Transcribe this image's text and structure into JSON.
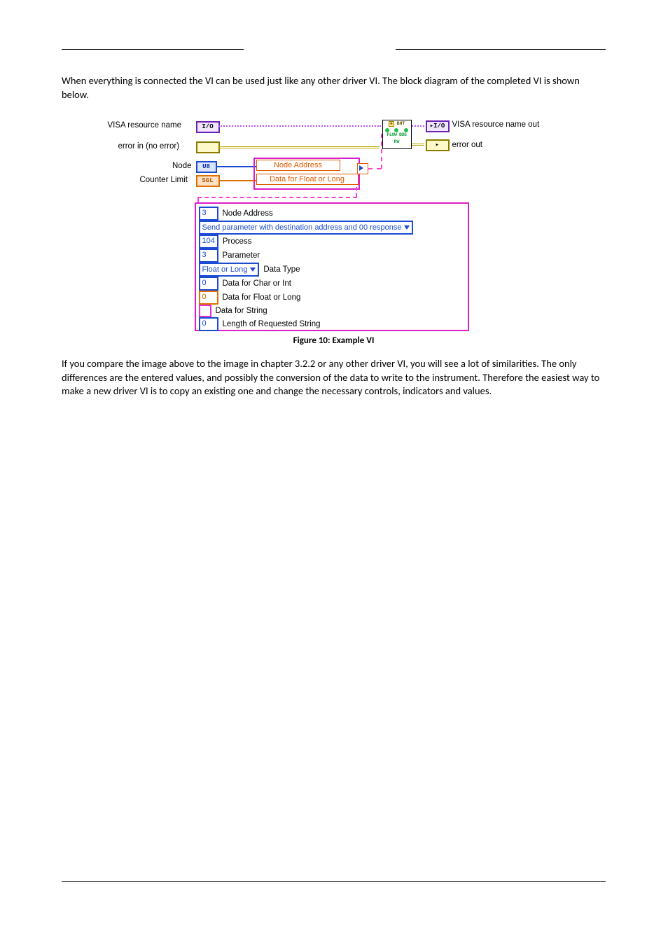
{
  "paragraphs": {
    "intro": "When everything is connected the VI can be used just like any other driver VI. The block diagram of the completed VI is shown below.",
    "outro": "If you compare the image above to the image in chapter 3.2.2 or any other driver VI, you will see a lot of similarities. The only differences are the entered values, and possibly the conversion of the data to write to the instrument. Therefore the easiest way to make a new driver VI is to copy an existing one and change the necessary controls, indicators and values."
  },
  "caption": "Figure 10: Example VI",
  "diagram": {
    "labels": {
      "visa_in": "VISA resource name",
      "visa_out": "VISA resource name out",
      "error_in": "error in (no error)",
      "error_out": "error out",
      "node": "Node",
      "counter_limit": "Counter Limit",
      "node_address": "Node Address",
      "data_float_long": "Data for Float or Long"
    },
    "terminals": {
      "io": "I/O",
      "io_out": "I/O",
      "err_in": "",
      "err_out": "",
      "u8": "U8",
      "sgl": "SGL"
    },
    "subvi": {
      "title": "BHT",
      "line1": "FLOW BUS",
      "line2": "RW"
    },
    "cluster": {
      "node_addr_val": "3",
      "node_addr_lbl": "Node Address",
      "send_param": "Send parameter with destination address and 00 response",
      "process_val": "104",
      "process_lbl": "Process",
      "parameter_val": "3",
      "parameter_lbl": "Parameter",
      "dtype_sel": "Float or Long",
      "dtype_lbl": "Data Type",
      "char_int_val": "0",
      "char_int_lbl": "Data for Char or Int",
      "float_long_val": "0",
      "float_long_lbl": "Data for Float or Long",
      "string_lbl": "Data for String",
      "len_val": "0",
      "len_lbl": "Length of Requested String"
    }
  }
}
